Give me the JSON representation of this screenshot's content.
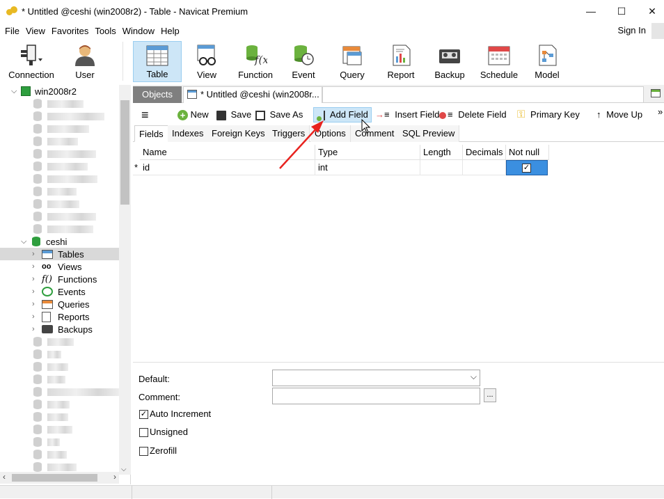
{
  "window": {
    "title": "* Untitled @ceshi (win2008r2) - Table - Navicat Premium",
    "minimize": "—",
    "maximize": "☐",
    "close": "✕"
  },
  "menu": {
    "items": [
      "File",
      "View",
      "Favorites",
      "Tools",
      "Window",
      "Help"
    ],
    "sign_in": "Sign In"
  },
  "toolbar": {
    "connection": "Connection",
    "user": "User",
    "table": "Table",
    "view": "View",
    "function": "Function",
    "event": "Event",
    "query": "Query",
    "report": "Report",
    "backup": "Backup",
    "schedule": "Schedule",
    "model": "Model"
  },
  "tree": {
    "connection": "win2008r2",
    "database": "ceshi",
    "children": [
      "Tables",
      "Views",
      "Functions",
      "Events",
      "Queries",
      "Reports",
      "Backups"
    ]
  },
  "tabs": {
    "objects": "Objects",
    "document": "* Untitled @ceshi (win2008r..."
  },
  "editor_toolbar": {
    "new": "New",
    "save": "Save",
    "save_as": "Save As",
    "add_field": "Add Field",
    "insert_field": "Insert Field",
    "delete_field": "Delete Field",
    "primary_key": "Primary Key",
    "move_up": "Move Up",
    "more": "»"
  },
  "subtabs": [
    "Fields",
    "Indexes",
    "Foreign Keys",
    "Triggers",
    "Options",
    "Comment",
    "SQL Preview"
  ],
  "grid": {
    "headers": [
      "Name",
      "Type",
      "Length",
      "Decimals",
      "Not null"
    ],
    "row_marker": "*",
    "rows": [
      {
        "name": "id",
        "type": "int",
        "length": "",
        "decimals": "",
        "not_null": true
      }
    ]
  },
  "props": {
    "default_label": "Default:",
    "comment_label": "Comment:",
    "comment_btn": "...",
    "auto_increment": "Auto Increment",
    "unsigned": "Unsigned",
    "zerofill": "Zerofill"
  },
  "colors": {
    "accent": "#cde6f7",
    "db_green": "#2e9e3e",
    "annotation_arrow": "#e8231f"
  }
}
